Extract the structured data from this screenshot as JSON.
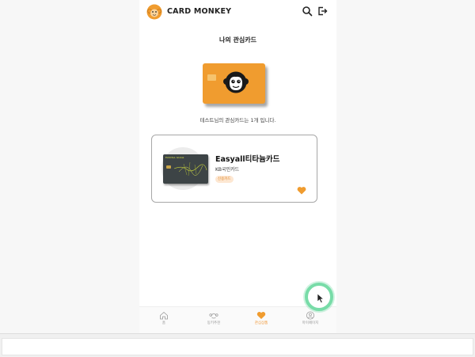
{
  "header": {
    "brand": "CARD MONKEY",
    "logo_icon": "monkey-logo-icon",
    "search_icon": "search-icon",
    "logout_icon": "logout-icon"
  },
  "page": {
    "title": "나의 관심카드",
    "summary": "테스트님의 관심카드는 1개 입니다."
  },
  "favorite_card": {
    "name": "Easyall티타늄카드",
    "issuer": "KB국민카드",
    "tag": "신용카드",
    "mini_card_text": "EASYALL Global",
    "liked": true
  },
  "nav": {
    "items": [
      {
        "label": "홈",
        "icon": "home-icon",
        "active": false
      },
      {
        "label": "동키추천",
        "icon": "monkey-icon",
        "active": false
      },
      {
        "label": "관심상품",
        "icon": "heart-icon",
        "active": true
      },
      {
        "label": "마이페이지",
        "icon": "user-icon",
        "active": false
      }
    ]
  },
  "colors": {
    "accent": "#f09c2f",
    "fab_ring": "#78dca8"
  }
}
